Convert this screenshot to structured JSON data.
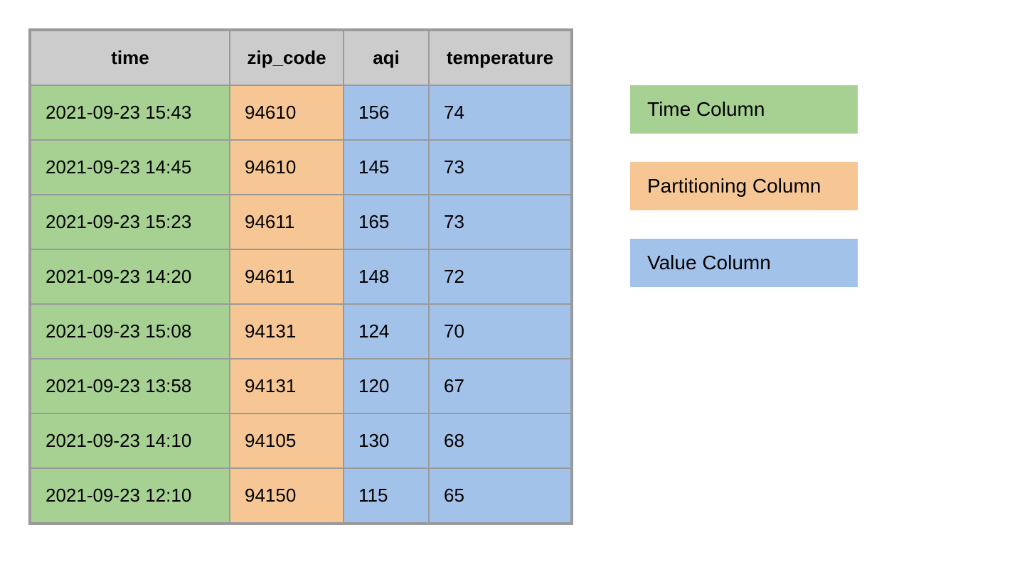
{
  "table": {
    "headers": {
      "time": "time",
      "zip_code": "zip_code",
      "aqi": "aqi",
      "temperature": "temperature"
    },
    "rows": [
      {
        "time": "2021-09-23 15:43",
        "zip_code": "94610",
        "aqi": "156",
        "temperature": "74"
      },
      {
        "time": "2021-09-23 14:45",
        "zip_code": "94610",
        "aqi": "145",
        "temperature": "73"
      },
      {
        "time": "2021-09-23 15:23",
        "zip_code": "94611",
        "aqi": "165",
        "temperature": "73"
      },
      {
        "time": "2021-09-23 14:20",
        "zip_code": "94611",
        "aqi": "148",
        "temperature": "72"
      },
      {
        "time": "2021-09-23 15:08",
        "zip_code": "94131",
        "aqi": "124",
        "temperature": "70"
      },
      {
        "time": "2021-09-23 13:58",
        "zip_code": "94131",
        "aqi": "120",
        "temperature": "67"
      },
      {
        "time": "2021-09-23 14:10",
        "zip_code": "94105",
        "aqi": "130",
        "temperature": "68"
      },
      {
        "time": "2021-09-23 12:10",
        "zip_code": "94150",
        "aqi": "115",
        "temperature": "65"
      }
    ]
  },
  "legend": {
    "time": "Time Column",
    "partitioning": "Partitioning Column",
    "value": "Value Column"
  },
  "colors": {
    "header_bg": "#cccccc",
    "time_col": "#a6d192",
    "partition_col": "#f6c795",
    "value_col": "#a3c2ea",
    "border": "#9a9a9a"
  }
}
